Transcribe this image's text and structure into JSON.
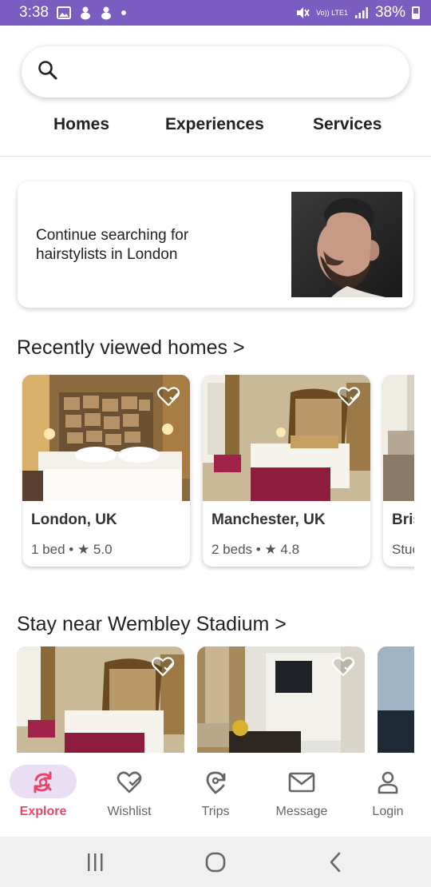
{
  "status_bar": {
    "time": "3:38",
    "network": "Vo)) LTE1",
    "battery": "38%",
    "bg_color": "#7b5cc0"
  },
  "search": {
    "placeholder": "",
    "icon": "search-icon"
  },
  "tabs": [
    {
      "label": "Homes"
    },
    {
      "label": "Experiences"
    },
    {
      "label": "Services"
    }
  ],
  "continue_card": {
    "text": "Continue searching for hairstylists in London",
    "image": "man-portrait-photo"
  },
  "recently_viewed": {
    "title": "Recently viewed homes >",
    "cards": [
      {
        "title": "London, UK",
        "subtitle": "1 bed • ★ 5.0",
        "image": "hotel-room-photo"
      },
      {
        "title": "Manchester, UK",
        "subtitle": "2 beds • ★ 4.8",
        "image": "hotel-room-photo"
      },
      {
        "title": "Bris",
        "subtitle": "Stuc",
        "image": "hotel-room-photo"
      }
    ]
  },
  "wembley": {
    "title": "Stay near Wembley Stadium >",
    "cards": [
      {
        "image": "hotel-room-photo"
      },
      {
        "image": "hotel-suite-photo"
      },
      {
        "image": "hotel-office-photo"
      }
    ]
  },
  "bottom_nav": {
    "accent_color": "#e8456b",
    "items": [
      {
        "label": "Explore",
        "icon": "explore-icon",
        "active": true
      },
      {
        "label": "Wishlist",
        "icon": "heart-check-icon",
        "active": false
      },
      {
        "label": "Trips",
        "icon": "trips-icon",
        "active": false
      },
      {
        "label": "Message",
        "icon": "envelope-icon",
        "active": false
      },
      {
        "label": "Login",
        "icon": "person-icon",
        "active": false
      }
    ]
  },
  "system_bar": {
    "buttons": [
      "recents-icon",
      "home-icon",
      "back-icon"
    ]
  }
}
